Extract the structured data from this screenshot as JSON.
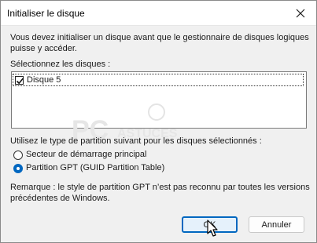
{
  "window": {
    "title": "Initialiser le disque"
  },
  "intro": {
    "line1": "Vous devez initialiser un disque avant que le gestionnaire de disques logiques",
    "line2": "puisse y accéder."
  },
  "disks": {
    "label": "Sélectionnez les disques :",
    "items": [
      {
        "label": "Disque 5",
        "checked": true
      }
    ]
  },
  "partition": {
    "label": "Utilisez le type de partition suivant pour les disques sélectionnés :",
    "options": [
      {
        "label": "Secteur de démarrage principal",
        "selected": false
      },
      {
        "label": "Partition GPT (GUID Partition Table)",
        "selected": true
      }
    ]
  },
  "note": {
    "line1": "Remarque : le style de partition GPT n’est pas reconnu par toutes les versions",
    "line2": "précédentes de Windows."
  },
  "buttons": {
    "ok": "OK",
    "cancel": "Annuler"
  },
  "watermark": {
    "text_main": "PC",
    "text_sub": "ASTUCES"
  },
  "colors": {
    "accent": "#0067c0",
    "dialog_bg": "#f0f0f0"
  },
  "icons": {
    "close": "close-icon",
    "check": "checkmark-icon",
    "cursor": "mouse-pointer-icon"
  }
}
